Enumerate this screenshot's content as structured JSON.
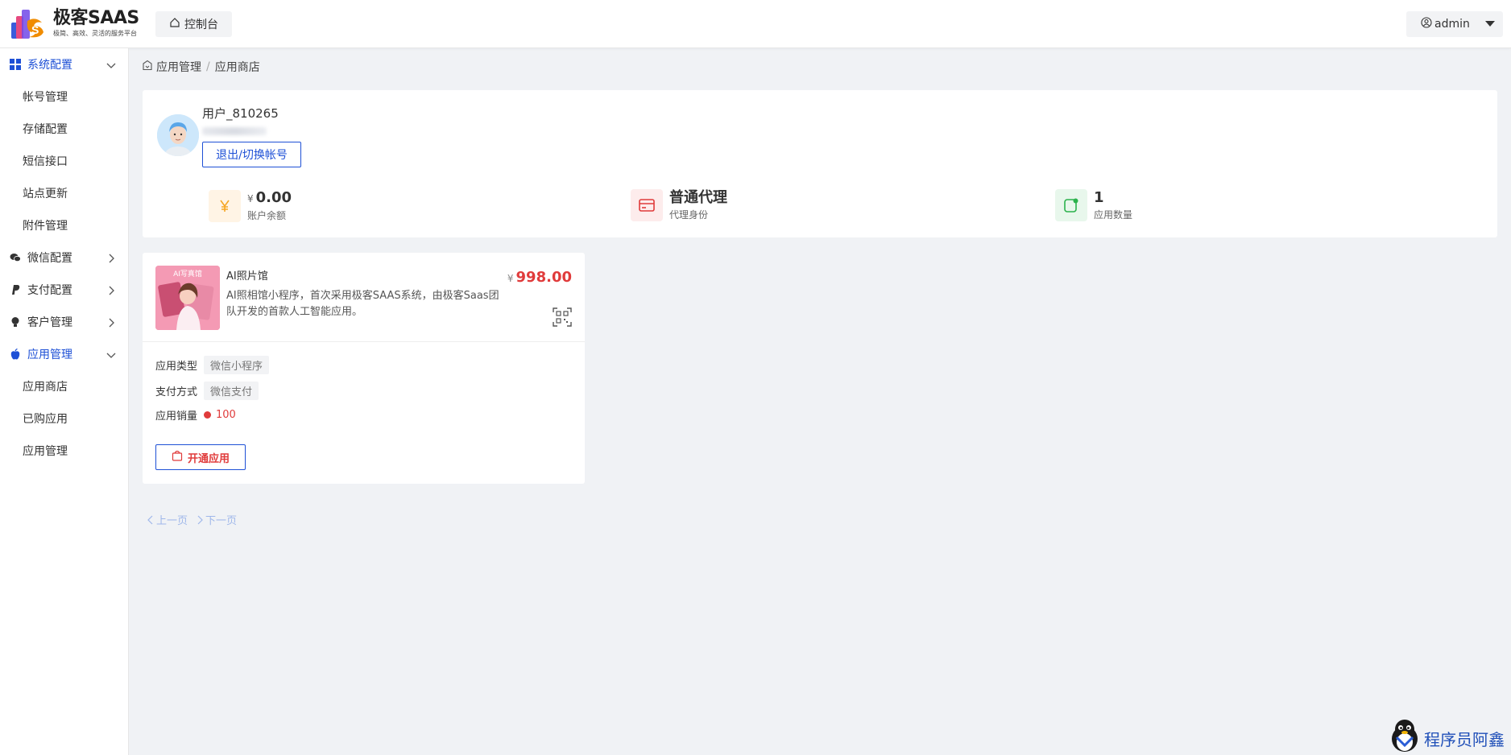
{
  "brand": {
    "title": "极客SAAS",
    "subtitle": "极简、高效、灵活的服务平台"
  },
  "header": {
    "console_label": "控制台",
    "user_label": "admin"
  },
  "sidebar": {
    "groups": [
      {
        "label": "系统配置",
        "icon": "grid-icon",
        "expanded": true,
        "active": true,
        "items": [
          "帐号管理",
          "存储配置",
          "短信接口",
          "站点更新",
          "附件管理"
        ]
      },
      {
        "label": "微信配置",
        "icon": "wechat-icon",
        "expanded": false,
        "items": []
      },
      {
        "label": "支付配置",
        "icon": "paypal-icon",
        "expanded": false,
        "items": []
      },
      {
        "label": "客户管理",
        "icon": "user-bulb-icon",
        "expanded": false,
        "items": []
      },
      {
        "label": "应用管理",
        "icon": "apple-icon",
        "expanded": true,
        "active": true,
        "items": [
          "应用商店",
          "已购应用",
          "应用管理"
        ]
      }
    ]
  },
  "breadcrumb": {
    "items": [
      "应用管理",
      "应用商店"
    ],
    "separator": "/"
  },
  "profile": {
    "username": "用户_810265",
    "switch_label": "退出/切换帐号",
    "stats": [
      {
        "currency": "¥",
        "value": "0.00",
        "label": "账户余额",
        "icon": "yen-icon",
        "color": "#f5a623"
      },
      {
        "value": "普通代理",
        "label": "代理身份",
        "icon": "card-icon",
        "color": "#e03b3b"
      },
      {
        "value": "1",
        "label": "应用数量",
        "icon": "app-icon",
        "color": "#2bb24c"
      }
    ]
  },
  "app": {
    "thumb_text": "AI写真馆",
    "name": "AI照片馆",
    "description": "AI照相馆小程序，首次采用极客SAAS系统，由极客Saas团队开发的首款人工智能应用。",
    "currency": "¥",
    "price": "998.00",
    "type_label": "应用类型",
    "type_value": "微信小程序",
    "pay_label": "支付方式",
    "pay_value": "微信支付",
    "sales_label": "应用销量",
    "sales_value": "100",
    "open_label": "开通应用"
  },
  "pager": {
    "prev": "上一页",
    "next": "下一页"
  },
  "watermark": {
    "text": "程序员阿鑫"
  },
  "colors": {
    "primary": "#1e50d6",
    "price": "#e03b3b",
    "bg": "#f0f2f5"
  }
}
